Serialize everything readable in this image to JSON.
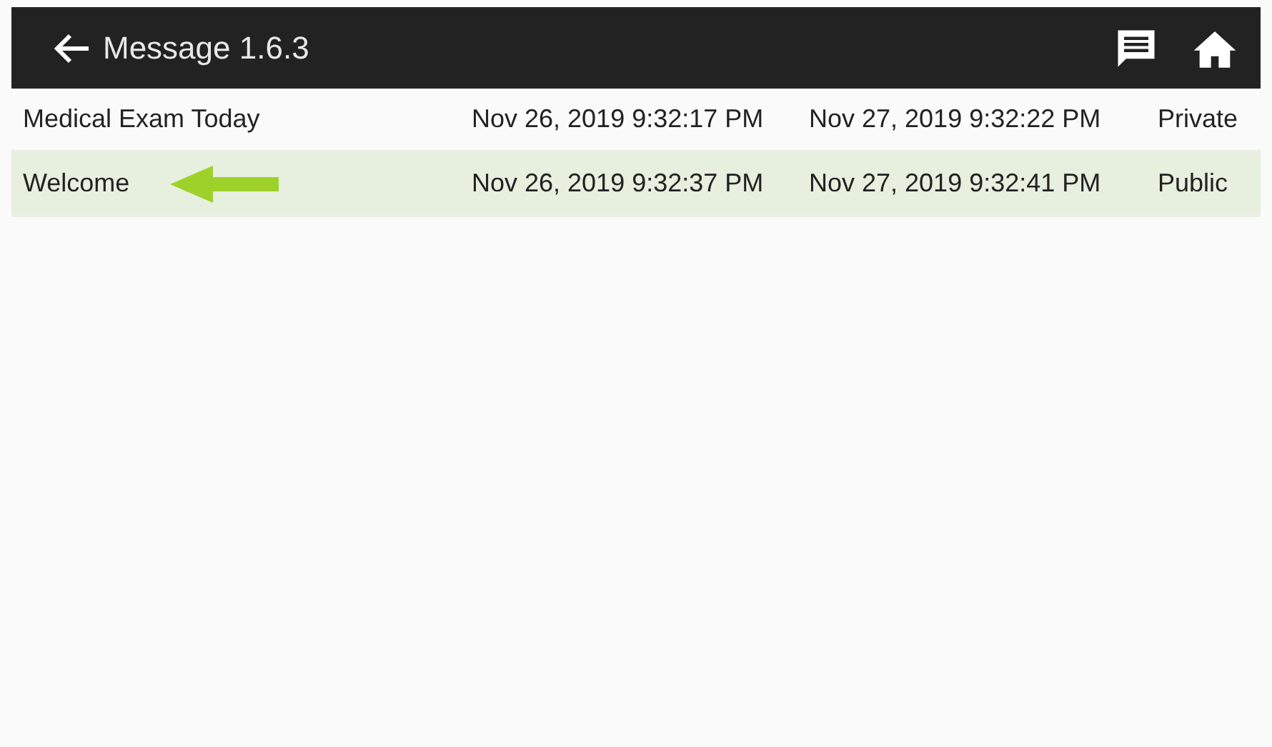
{
  "header": {
    "title": "Message 1.6.3"
  },
  "messages": [
    {
      "title": "Medical Exam Today",
      "start": "Nov 26, 2019 9:32:17 PM",
      "end": "Nov 27, 2019 9:32:22 PM",
      "scope": "Private",
      "selected": false,
      "pointer": false
    },
    {
      "title": "Welcome",
      "start": "Nov 26, 2019 9:32:37 PM",
      "end": "Nov 27, 2019 9:32:41 PM",
      "scope": "Public",
      "selected": true,
      "pointer": true
    }
  ]
}
